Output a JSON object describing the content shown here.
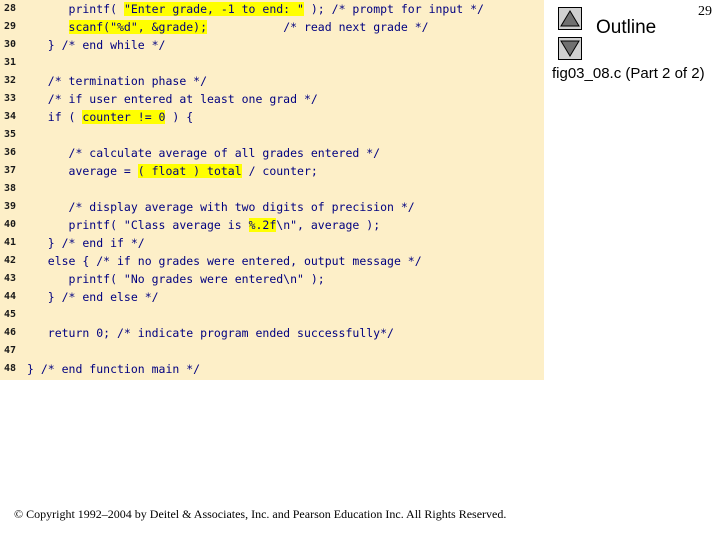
{
  "code": {
    "lines": [
      {
        "num": "28",
        "pre": "      printf( ",
        "hl": "\"Enter grade, -1 to end: \"",
        "post": " ); /* prompt for input */"
      },
      {
        "num": "29",
        "pre": "      ",
        "hl": "scanf(\"%d\", &grade);",
        "post": "           /* read next grade */"
      },
      {
        "num": "30",
        "pre": "   } /* end while */",
        "hl": "",
        "post": ""
      },
      {
        "num": "31",
        "pre": "",
        "hl": "",
        "post": ""
      },
      {
        "num": "32",
        "pre": "   /* termination phase */",
        "hl": "",
        "post": ""
      },
      {
        "num": "33",
        "pre": "   /* if user entered at least one grad */",
        "hl": "",
        "post": ""
      },
      {
        "num": "34",
        "pre": "   if ( ",
        "hl": "counter != 0",
        "post": " ) {"
      },
      {
        "num": "35",
        "pre": "",
        "hl": "",
        "post": ""
      },
      {
        "num": "36",
        "pre": "      /* calculate average of all grades entered */",
        "hl": "",
        "post": ""
      },
      {
        "num": "37",
        "pre": "      average = ",
        "hl": "( float ) total",
        "post": " / counter;"
      },
      {
        "num": "38",
        "pre": "",
        "hl": "",
        "post": ""
      },
      {
        "num": "39",
        "pre": "      /* display average with two digits of precision */",
        "hl": "",
        "post": ""
      },
      {
        "num": "40",
        "pre": "      printf( \"Class average is ",
        "hl": "%.2f",
        "post": "\\n\", average );"
      },
      {
        "num": "41",
        "pre": "   } /* end if */",
        "hl": "",
        "post": ""
      },
      {
        "num": "42",
        "pre": "   else { /* if no grades were entered, output message */",
        "hl": "",
        "post": ""
      },
      {
        "num": "43",
        "pre": "      printf( \"No grades were entered\\n\" );",
        "hl": "",
        "post": ""
      },
      {
        "num": "44",
        "pre": "   } /* end else */",
        "hl": "",
        "post": ""
      },
      {
        "num": "45",
        "pre": "",
        "hl": "",
        "post": ""
      },
      {
        "num": "46",
        "pre": "   return 0; /* indicate program ended successfully*/",
        "hl": "",
        "post": ""
      },
      {
        "num": "47",
        "pre": "",
        "hl": "",
        "post": ""
      },
      {
        "num": "48",
        "pre": "} /* end function main */",
        "hl": "",
        "post": ""
      }
    ]
  },
  "sidebar": {
    "outline_label": "Outline",
    "page_number": "29",
    "caption": "fig03_08.c (Part 2 of 2)"
  },
  "footer": {
    "copyright": "© Copyright 1992–2004 by Deitel & Associates, Inc. and Pearson Education Inc. All Rights Reserved."
  },
  "colors": {
    "code_background": "#fdefc8",
    "highlight": "#ffff00",
    "code_text": "#000080"
  },
  "icons": {
    "prev": "triangle-up-icon",
    "next": "triangle-down-icon"
  }
}
